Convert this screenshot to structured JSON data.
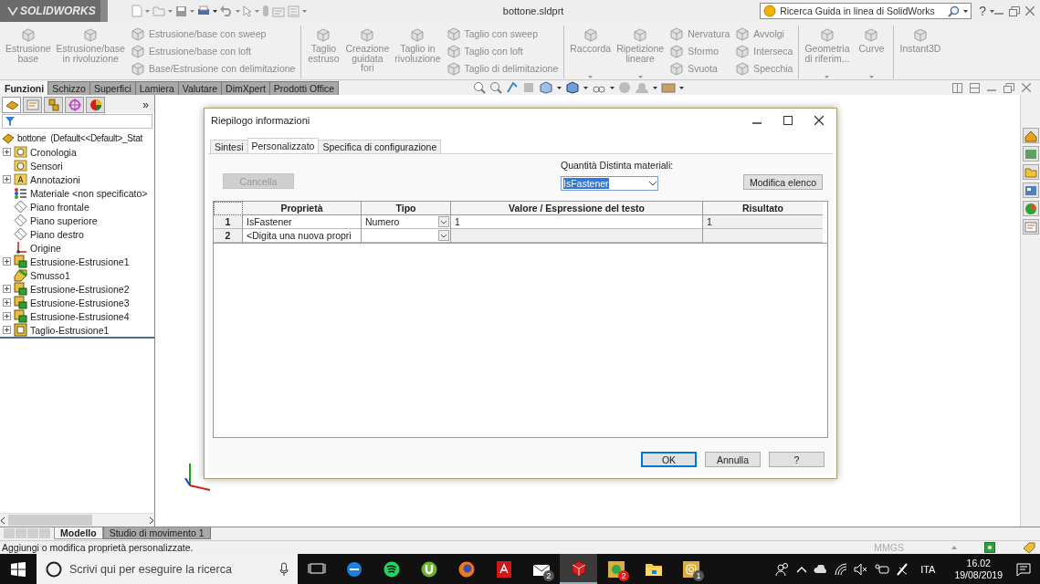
{
  "app": {
    "logo": "SOLIDWORKS",
    "title": "bottone.sldprt",
    "help_search": {
      "placeholder": "Ricerca Guida in linea di SolidWorks"
    },
    "help_button": "?"
  },
  "ribbon": {
    "groups": [
      {
        "columns": [
          {
            "kind": "large",
            "label": "Estrusione\nbase",
            "dropdown": false
          },
          {
            "kind": "large",
            "label": "Estrusione/base\nin rivoluzione",
            "dropdown": false
          },
          {
            "kind": "stack",
            "items": [
              "Estrusione/base con sweep",
              "Estrusione/base con loft",
              "Base/Estrusione con delimitazione"
            ]
          }
        ]
      },
      {
        "columns": [
          {
            "kind": "large",
            "label": "Taglio\nestruso",
            "dropdown": false
          },
          {
            "kind": "large",
            "label": "Creazione\nguidata\nfori",
            "dropdown": false
          },
          {
            "kind": "large",
            "label": "Taglio in\nrivoluzione",
            "dropdown": false
          },
          {
            "kind": "stack",
            "items": [
              "Taglio con sweep",
              "Taglio con loft",
              "Taglio di delimitazione"
            ]
          }
        ]
      },
      {
        "columns": [
          {
            "kind": "large",
            "label": "Raccorda",
            "dropdown": true
          },
          {
            "kind": "large",
            "label": "Ripetizione\nlineare",
            "dropdown": true
          },
          {
            "kind": "stack",
            "items": [
              "Nervatura",
              "Sformo",
              "Svuota"
            ]
          },
          {
            "kind": "stack",
            "items": [
              "Avvolgi",
              "Interseca",
              "Specchia"
            ]
          }
        ]
      },
      {
        "columns": [
          {
            "kind": "large",
            "label": "Geometria\ndi riferim...",
            "dropdown": true
          },
          {
            "kind": "large",
            "label": "Curve",
            "dropdown": true
          }
        ]
      },
      {
        "columns": [
          {
            "kind": "large",
            "label": "Instant3D",
            "dropdown": false
          }
        ]
      }
    ]
  },
  "command_tabs": [
    {
      "label": "Funzioni",
      "selected": true
    },
    {
      "label": "Schizzo",
      "selected": false
    },
    {
      "label": "Superfici",
      "selected": false
    },
    {
      "label": "Lamiera",
      "selected": false
    },
    {
      "label": "Valutare",
      "selected": false
    },
    {
      "label": "DimXpert",
      "selected": false
    },
    {
      "label": "Prodotti Office",
      "selected": false
    }
  ],
  "feature_tree": {
    "more": "»",
    "root": "bottone  (Default<<Default>_Stat",
    "children": [
      {
        "label": "Cronologia",
        "kind": "history",
        "expandable": true
      },
      {
        "label": "Sensori",
        "kind": "sensor",
        "expandable": false
      },
      {
        "label": "Annotazioni",
        "kind": "annotation",
        "expandable": true
      },
      {
        "label": "Materiale <non specificato>",
        "kind": "material",
        "expandable": false
      },
      {
        "label": "Piano frontale",
        "kind": "plane",
        "expandable": false
      },
      {
        "label": "Piano superiore",
        "kind": "plane",
        "expandable": false
      },
      {
        "label": "Piano destro",
        "kind": "plane",
        "expandable": false
      },
      {
        "label": "Origine",
        "kind": "origin",
        "expandable": false
      },
      {
        "label": "Estrusione-Estrusione1",
        "kind": "extrude",
        "expandable": true
      },
      {
        "label": "Smusso1",
        "kind": "chamfer",
        "expandable": false
      },
      {
        "label": "Estrusione-Estrusione2",
        "kind": "extrude",
        "expandable": true
      },
      {
        "label": "Estrusione-Estrusione3",
        "kind": "extrude",
        "expandable": true
      },
      {
        "label": "Estrusione-Estrusione4",
        "kind": "extrude",
        "expandable": true
      },
      {
        "label": "Taglio-Estrusione1",
        "kind": "cut",
        "expandable": true
      }
    ]
  },
  "dialog": {
    "title": "Riepilogo informazioni",
    "tabs": [
      {
        "label": "Sintesi",
        "selected": false
      },
      {
        "label": "Personalizzato",
        "selected": true
      },
      {
        "label": "Specifica di configurazione",
        "selected": false
      }
    ],
    "delete_button": {
      "label": "Cancella",
      "disabled": true
    },
    "bom_quantity": {
      "label": "Quantità Distinta materiali:",
      "value": "IsFastener"
    },
    "edit_list_button": "Modifica elenco",
    "table": {
      "columns": [
        "Proprietà",
        "Tipo",
        "Valore / Espressione del testo",
        "Risultato"
      ],
      "rows": [
        {
          "number": "1",
          "property": "IsFastener",
          "type": "Numero",
          "value": "1",
          "result": "1"
        },
        {
          "number": "2",
          "property": "<Digita una nuova propri"
        }
      ]
    },
    "buttons": [
      {
        "label": "OK",
        "default": true
      },
      {
        "label": "Annulla",
        "default": false
      },
      {
        "label": "?",
        "default": false
      }
    ]
  },
  "bottom_tabs": [
    {
      "label": "Modello",
      "selected": true
    },
    {
      "label": "Studio di movimento 1",
      "selected": false
    }
  ],
  "status_bar": {
    "message": "Aggiungi o modifica proprietà personalizzate.",
    "units": "MMGS"
  },
  "taskbar": {
    "search": {
      "placeholder": "Scrivi qui per eseguire la ricerca"
    },
    "apps": [
      {
        "kind": "taskview",
        "active": false
      },
      {
        "kind": "edge",
        "active": false
      },
      {
        "kind": "spotify",
        "active": false
      },
      {
        "kind": "torrent",
        "active": false
      },
      {
        "kind": "firefox",
        "active": false
      },
      {
        "kind": "pdf",
        "active": false
      },
      {
        "kind": "mail",
        "active": false,
        "badge": "2"
      },
      {
        "kind": "cad",
        "active": true
      },
      {
        "kind": "chat",
        "active": false,
        "badge": "2"
      },
      {
        "kind": "folder",
        "active": false
      },
      {
        "kind": "camera",
        "active": false,
        "badge": "1"
      }
    ],
    "language": "ITA",
    "time": "16.02",
    "date": "19/08/2019"
  }
}
